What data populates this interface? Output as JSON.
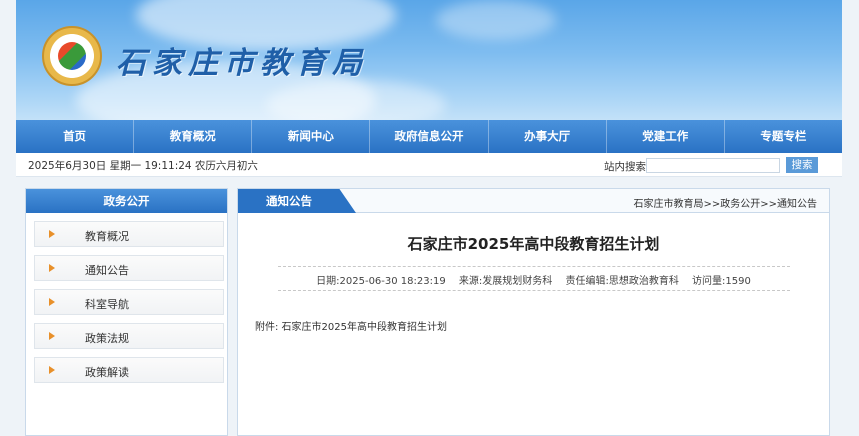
{
  "header": {
    "site_title": "石家庄市教育局"
  },
  "nav": {
    "items": [
      "首页",
      "教育概况",
      "新闻中心",
      "政府信息公开",
      "办事大厅",
      "党建工作",
      "专题专栏"
    ]
  },
  "infobar": {
    "date_text": "2025年6月30日 星期一 19:11:24 农历六月初六",
    "search_label": "站内搜索:",
    "search_placeholder": "",
    "search_button": "搜索"
  },
  "sidebar": {
    "heading": "政务公开",
    "items": [
      "教育概况",
      "通知公告",
      "科室导航",
      "政策法规",
      "政策解读"
    ]
  },
  "main": {
    "tab_label": "通知公告",
    "breadcrumb": "石家庄市教育局>>政务公开>>通知公告",
    "title": "石家庄市2025年高中段教育招生计划",
    "meta": {
      "date": "日期:2025-06-30 18:23:19",
      "source": "来源:发展规划财务科",
      "editor": "责任编辑:思想政治教育科",
      "views": "访问量:1590"
    },
    "attachment": "附件: 石家庄市2025年高中段教育招生计划"
  },
  "colors": {
    "nav_blue": "#2a72c4",
    "accent_orange": "#e8902a",
    "title_blue": "#1f5fa8"
  }
}
